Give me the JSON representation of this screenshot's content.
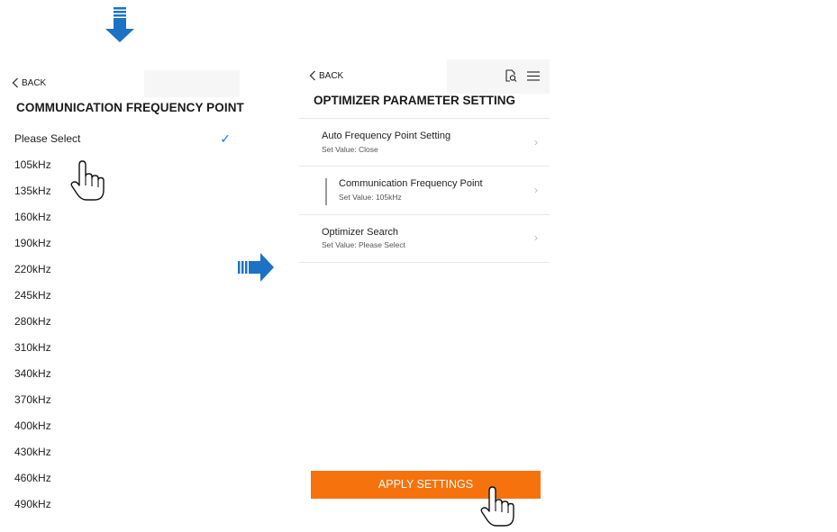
{
  "left": {
    "back_label": "BACK",
    "title": "COMMUNICATION FREQUENCY POINT",
    "options": [
      "Please Select",
      "105kHz",
      "135kHz",
      "160kHz",
      "190kHz",
      "220kHz",
      "245kHz",
      "280kHz",
      "310kHz",
      "340kHz",
      "370kHz",
      "400kHz",
      "430kHz",
      "460kHz",
      "490kHz"
    ],
    "selected": "Please Select"
  },
  "right": {
    "back_label": "BACK",
    "title": "OPTIMIZER PARAMETER SETTING",
    "rows": [
      {
        "title": "Auto Frequency Point Setting",
        "value": "Set Value: Close"
      },
      {
        "title": "Communication Frequency Point",
        "value": "Set Value: 105kHz"
      },
      {
        "title": "Optimizer Search",
        "value": "Set Value: Please Select"
      }
    ],
    "apply_label": "APPLY SETTINGS"
  },
  "colors": {
    "accent_orange": "#f5720d",
    "check_blue": "#1a73e8",
    "arrow_blue": "#1d72c4"
  },
  "icons": [
    "down-arrow-icon",
    "right-arrow-icon",
    "hand-pointer-icon",
    "chevron-left-icon",
    "chevron-right-icon",
    "search-document-icon",
    "menu-icon",
    "checkmark-icon"
  ]
}
